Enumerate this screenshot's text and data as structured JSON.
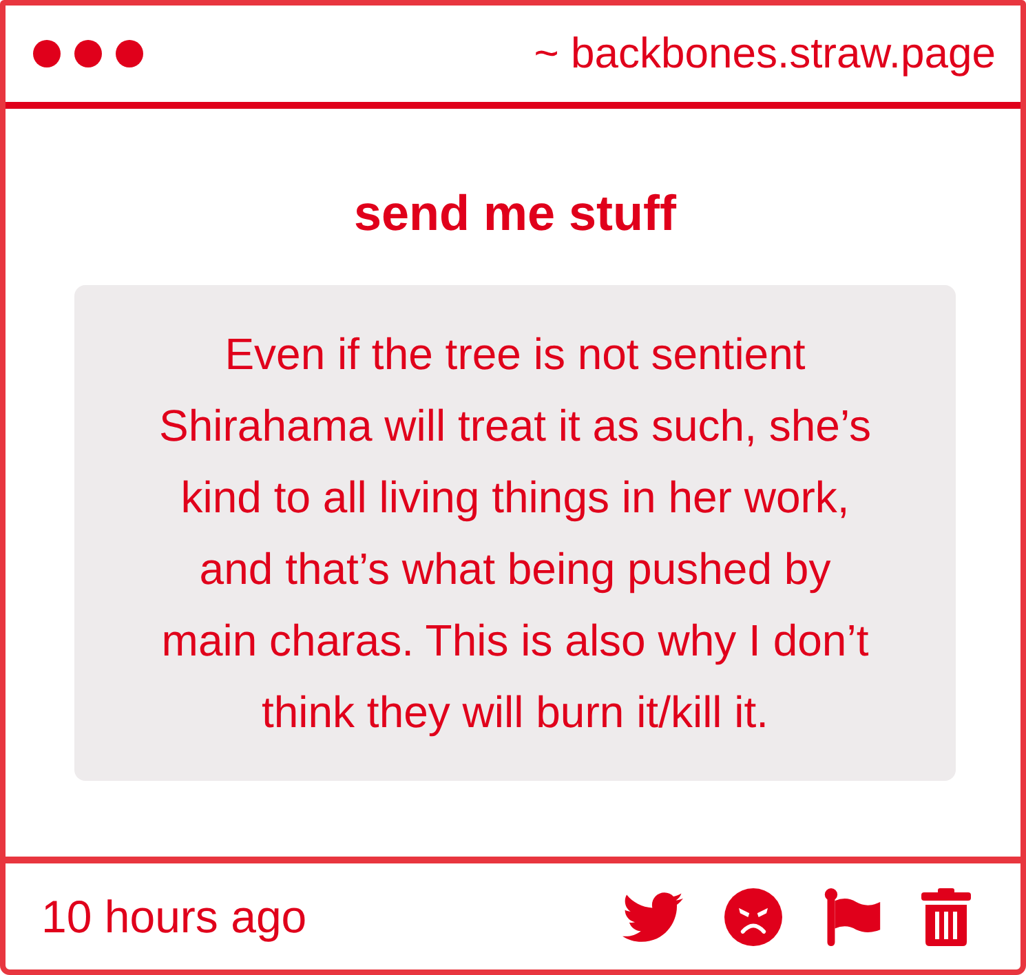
{
  "header": {
    "title": "~ backbones.straw.page"
  },
  "heading": "send me stuff",
  "message": "Even if the tree is not sentient Shirahama will treat it as such, she’s kind to all living things in her work, and that’s what being pushed by main charas. This is also why I don’t think they will burn it/kill it.",
  "footer": {
    "time": "10 hours ago",
    "actions": [
      {
        "kind": "bird"
      },
      {
        "kind": "angry"
      },
      {
        "kind": "flag"
      },
      {
        "kind": "trash"
      }
    ]
  }
}
